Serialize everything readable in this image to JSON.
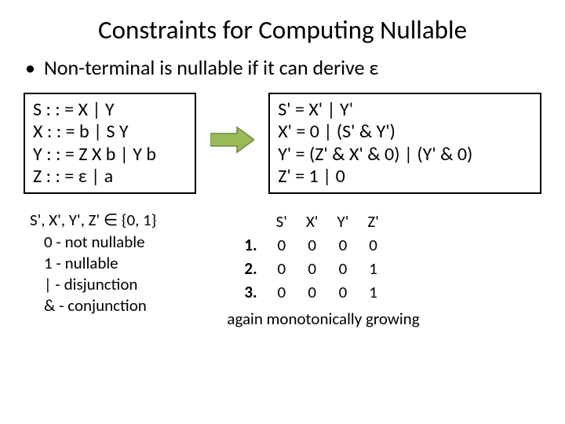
{
  "title": "Constraints for Computing Nullable",
  "bullet1": "Non-terminal is nullable if it can derive ε",
  "grammar": {
    "l1": "S : : = X | Y",
    "l2": "X : : = b | S Y",
    "l3": "Y : : = Z X b | Y b",
    "l4": "Z : : = ε | a"
  },
  "constraints": {
    "l1": "S' = X' | Y'",
    "l2": "X' = 0 | (S' & Y')",
    "l3": "Y' = (Z' & X' & 0) | (Y' & 0)",
    "l4": "Z' = 1 | 0"
  },
  "legend": {
    "l1": "S', X', Y', Z' ∈ {0, 1}",
    "l2": "0  - not nullable",
    "l3": "1  - nullable",
    "l4": "|  - disjunction",
    "l5": "& - conjunction"
  },
  "table": {
    "headers": [
      "",
      "S'",
      "X'",
      "Y'",
      "Z'"
    ],
    "rows": [
      [
        "1.",
        "0",
        "0",
        "0",
        "0"
      ],
      [
        "2.",
        "0",
        "0",
        "0",
        "1"
      ],
      [
        "3.",
        "0",
        "0",
        "0",
        "1"
      ]
    ]
  },
  "caption": "again monotonically growing",
  "chart_data": {
    "type": "table",
    "headers": [
      "S'",
      "X'",
      "Y'",
      "Z'"
    ],
    "rows": [
      {
        "step": 1,
        "S'": 0,
        "X'": 0,
        "Y'": 0,
        "Z'": 0
      },
      {
        "step": 2,
        "S'": 0,
        "X'": 0,
        "Y'": 0,
        "Z'": 1
      },
      {
        "step": 3,
        "S'": 0,
        "X'": 0,
        "Y'": 0,
        "Z'": 1
      }
    ]
  }
}
